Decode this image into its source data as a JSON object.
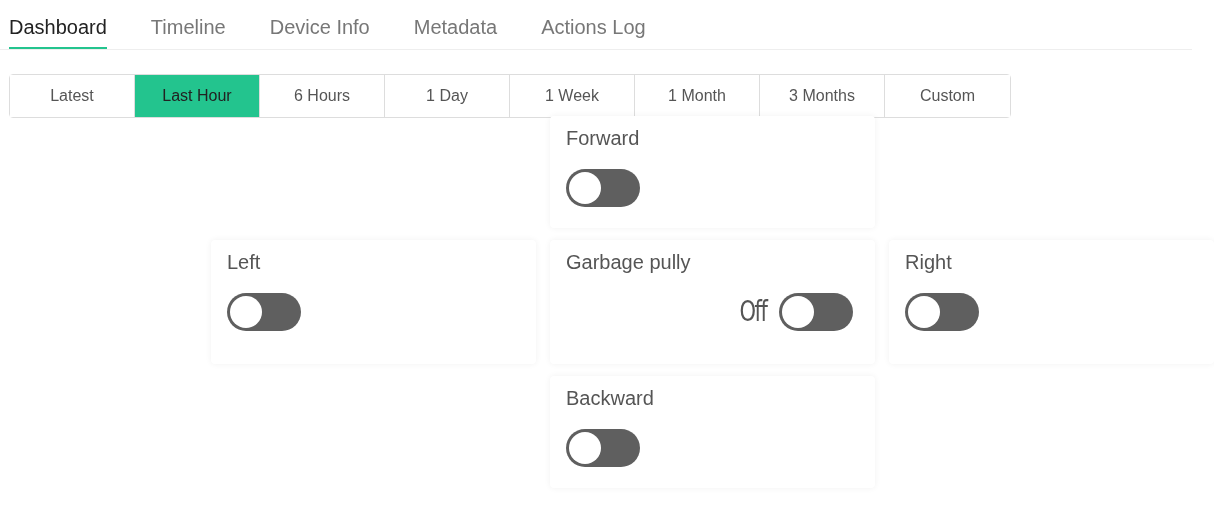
{
  "tabs": [
    {
      "label": "Dashboard",
      "selected": true
    },
    {
      "label": "Timeline",
      "selected": false
    },
    {
      "label": "Device Info",
      "selected": false
    },
    {
      "label": "Metadata",
      "selected": false
    },
    {
      "label": "Actions Log",
      "selected": false
    }
  ],
  "time_ranges": [
    {
      "label": "Latest",
      "selected": false
    },
    {
      "label": "Last Hour",
      "selected": true
    },
    {
      "label": "6 Hours",
      "selected": false
    },
    {
      "label": "1 Day",
      "selected": false
    },
    {
      "label": "1 Week",
      "selected": false
    },
    {
      "label": "1 Month",
      "selected": false
    },
    {
      "label": "3 Months",
      "selected": false
    },
    {
      "label": "Custom",
      "selected": false
    }
  ],
  "widget_rows": [
    {
      "cells": [
        {
          "kind": "empty"
        },
        {
          "kind": "switch",
          "title": "Forward",
          "on": false
        },
        {
          "kind": "empty"
        }
      ]
    },
    {
      "cells": [
        {
          "kind": "switch",
          "title": "Left",
          "on": false
        },
        {
          "kind": "switch",
          "title": "Garbage pully",
          "on": false,
          "status": "Off"
        },
        {
          "kind": "switch",
          "title": "Right",
          "on": false
        }
      ]
    },
    {
      "cells": [
        {
          "kind": "empty"
        },
        {
          "kind": "switch",
          "title": "Backward",
          "on": false
        },
        {
          "kind": "empty"
        }
      ]
    }
  ]
}
